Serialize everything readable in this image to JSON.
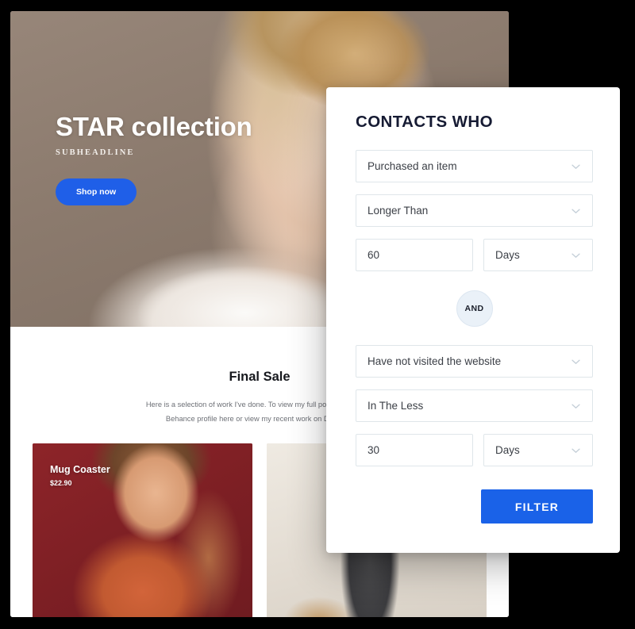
{
  "website": {
    "hero": {
      "title_strong": "STAR",
      "title_rest": " collection",
      "subheadline": "SUBHEADLINE",
      "cta_label": "Shop now",
      "cta_color": "#1f5fe8"
    },
    "section": {
      "title": "Final Sale",
      "description_line1": "Here is a selection of work I've done. To view my full portfolio, visit my",
      "description_line2": "Behance profile here or view my recent work on Dribbble."
    },
    "products": [
      {
        "name": "Mug Coaster",
        "price": "$22.90",
        "bg_color": "#7e1f24"
      },
      {
        "name": "",
        "price": "",
        "bg_color": "#ddd6cd"
      }
    ]
  },
  "panel": {
    "title": "CONTACTS WHO",
    "connector_label": "AND",
    "submit_label": "FILTER",
    "submit_color": "#1a62e8",
    "group_one": {
      "condition": "Purchased an item",
      "comparator": "Longer Than",
      "amount": "60",
      "unit": "Days"
    },
    "group_two": {
      "condition": "Have not visited the website",
      "comparator": "In The Less",
      "amount": "30",
      "unit": "Days"
    }
  }
}
